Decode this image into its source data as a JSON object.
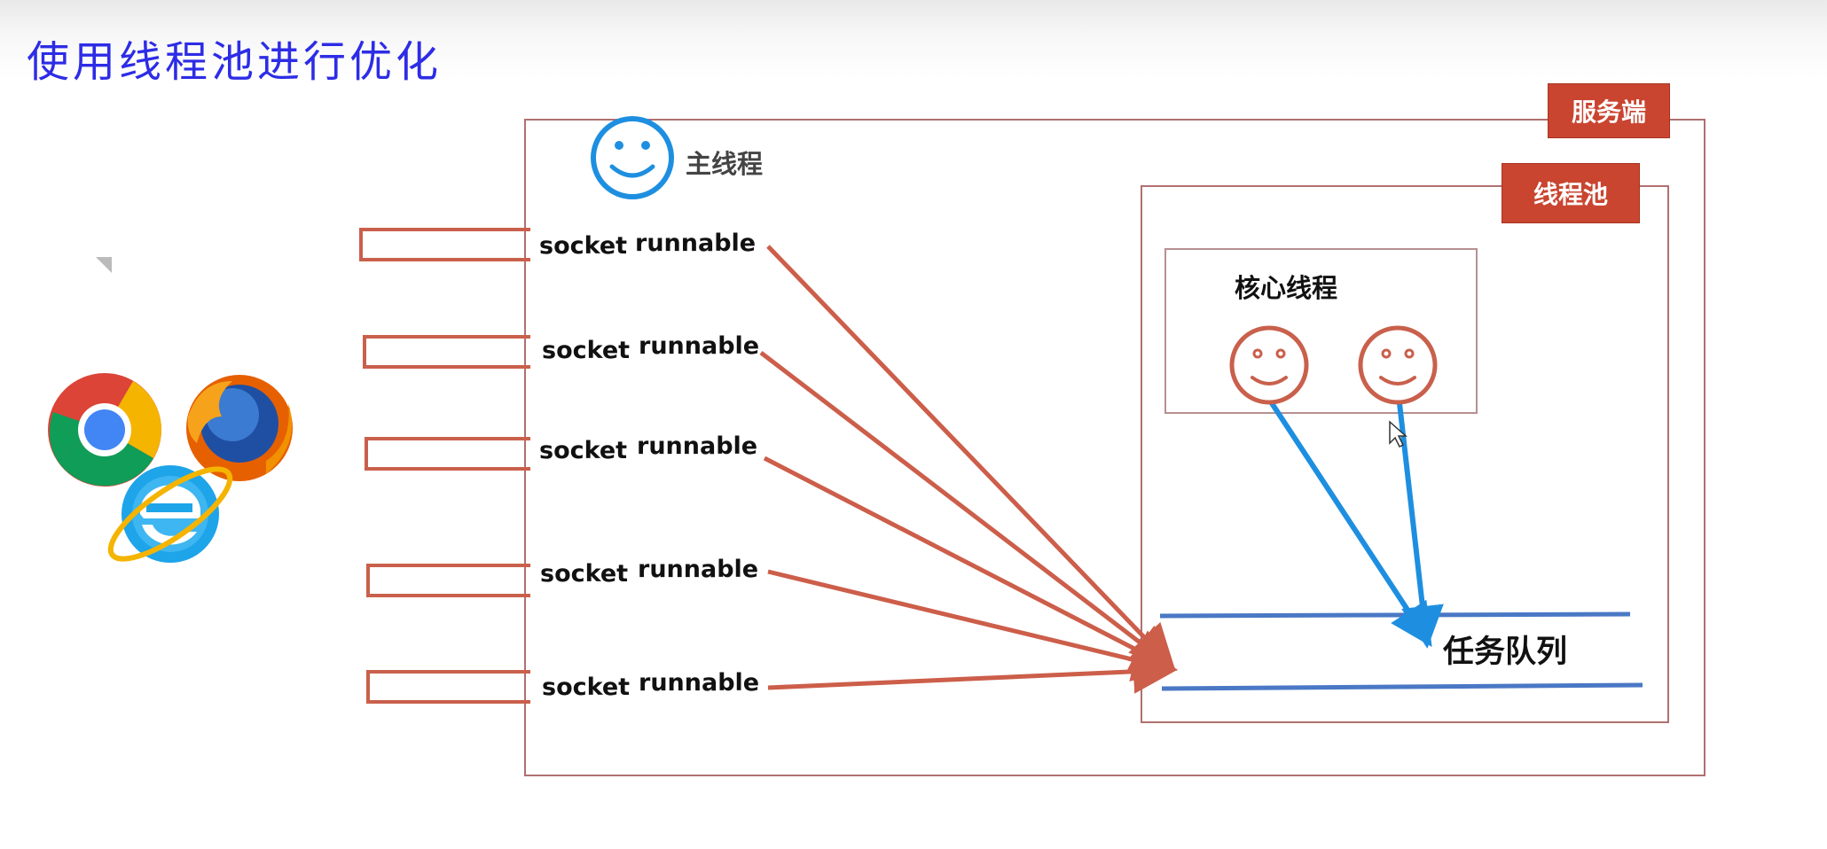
{
  "title": "使用线程池进行优化",
  "server": {
    "label": "服务端"
  },
  "pool": {
    "label": "线程池"
  },
  "main_thread": {
    "label": "主线程"
  },
  "core_threads": {
    "label": "核心线程"
  },
  "task_queue": {
    "label": "任务队列"
  },
  "connections": [
    {
      "socket": "socket",
      "task": "runnable"
    },
    {
      "socket": "socket",
      "task": "runnable"
    },
    {
      "socket": "socket",
      "task": "runnable"
    },
    {
      "socket": "socket",
      "task": "runnable"
    },
    {
      "socket": "socket",
      "task": "runnable"
    }
  ],
  "browsers": [
    "chrome-icon",
    "firefox-icon",
    "internet-explorer-icon"
  ],
  "colors": {
    "title": "#2d2ce6",
    "tag_bg": "#c94530",
    "task_arrow": "#cc5e4a",
    "worker_arrow": "#1e8fe0",
    "queue_line": "#4a78c5",
    "main_smiley": "#1e8fe0",
    "worker_smiley": "#c9604c"
  }
}
